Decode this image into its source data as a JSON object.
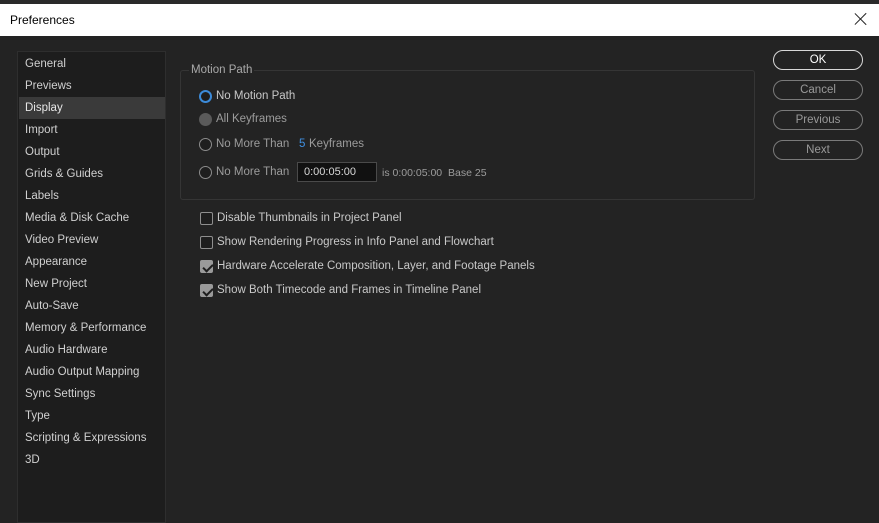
{
  "window": {
    "title": "Preferences"
  },
  "sidebar": {
    "items": [
      {
        "label": "General"
      },
      {
        "label": "Previews"
      },
      {
        "label": "Display"
      },
      {
        "label": "Import"
      },
      {
        "label": "Output"
      },
      {
        "label": "Grids & Guides"
      },
      {
        "label": "Labels"
      },
      {
        "label": "Media & Disk Cache"
      },
      {
        "label": "Video Preview"
      },
      {
        "label": "Appearance"
      },
      {
        "label": "New Project"
      },
      {
        "label": "Auto-Save"
      },
      {
        "label": "Memory & Performance"
      },
      {
        "label": "Audio Hardware"
      },
      {
        "label": "Audio Output Mapping"
      },
      {
        "label": "Sync Settings"
      },
      {
        "label": "Type"
      },
      {
        "label": "Scripting & Expressions"
      },
      {
        "label": "3D"
      }
    ],
    "selected": "Display"
  },
  "motion_path": {
    "title": "Motion Path",
    "no_motion_path": "No Motion Path",
    "all_keyframes": "All Keyframes",
    "no_more_than": "No More Than",
    "keyframes_count": "5",
    "keyframes_label": "Keyframes",
    "no_more_than_time": "No More Than",
    "timecode_value": "0:00:05:00",
    "timecode_is": "is 0:00:05:00",
    "timecode_base": "Base 25",
    "selected": "No Motion Path"
  },
  "options": {
    "disable_thumbnails": {
      "label": "Disable Thumbnails in Project Panel",
      "checked": false
    },
    "show_rendering": {
      "label": "Show Rendering Progress in Info Panel and Flowchart",
      "checked": false
    },
    "hw_accel": {
      "label": "Hardware Accelerate Composition, Layer, and Footage Panels",
      "checked": true
    },
    "show_both": {
      "label": "Show Both Timecode and Frames in Timeline Panel",
      "checked": true
    }
  },
  "buttons": {
    "ok": "OK",
    "cancel": "Cancel",
    "previous": "Previous",
    "next": "Next"
  }
}
